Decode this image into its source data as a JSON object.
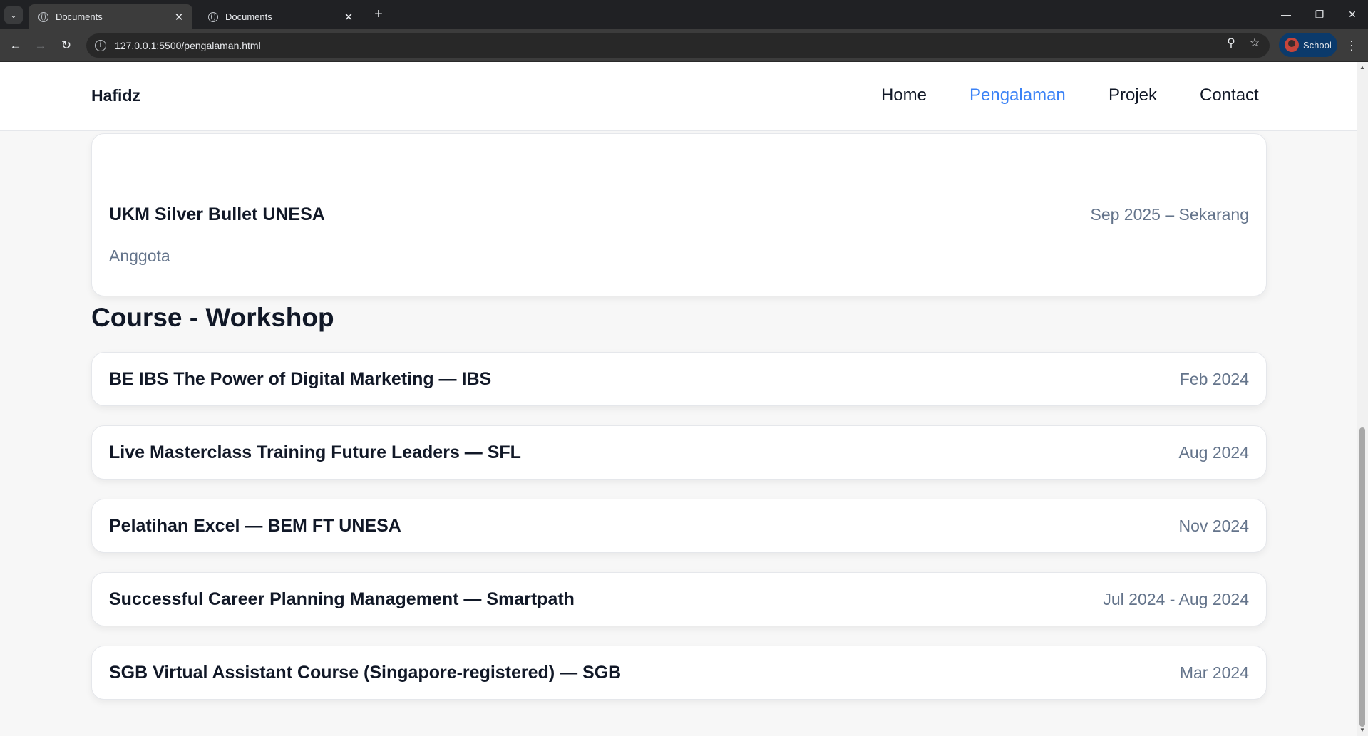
{
  "browser": {
    "tabs": [
      {
        "title": "Documents",
        "active": true
      },
      {
        "title": "Documents",
        "active": false
      }
    ],
    "url": "127.0.0.1:5500/pengalaman.html",
    "profile_label": "School"
  },
  "site": {
    "brand": "Hafidz",
    "nav": [
      {
        "label": "Home",
        "active": false
      },
      {
        "label": "Pengalaman",
        "active": true
      },
      {
        "label": "Projek",
        "active": false
      },
      {
        "label": "Contact",
        "active": false
      }
    ]
  },
  "organization": {
    "name": "UKM Silver Bullet UNESA",
    "date": "Sep 2025 – Sekarang",
    "role": "Anggota"
  },
  "courses": {
    "title": "Course - Workshop",
    "items": [
      {
        "name": "BE IBS The Power of Digital Marketing — IBS",
        "date": "Feb 2024"
      },
      {
        "name": "Live Masterclass Training Future Leaders — SFL",
        "date": "Aug 2024"
      },
      {
        "name": "Pelatihan Excel — BEM FT UNESA",
        "date": "Nov 2024"
      },
      {
        "name": "Successful Career Planning Management — Smartpath",
        "date": "Jul 2024 - Aug 2024"
      },
      {
        "name": "SGB Virtual Assistant Course (Singapore-registered) — SGB",
        "date": "Mar 2024"
      }
    ]
  },
  "colors": {
    "accent": "#3b82f6",
    "muted_text": "#64748b",
    "heading_text": "#111827"
  }
}
